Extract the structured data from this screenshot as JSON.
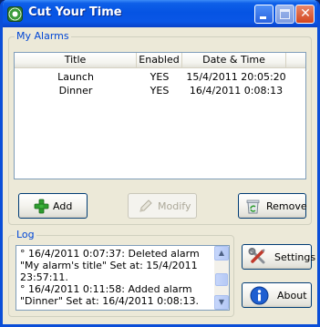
{
  "window": {
    "title": "Cut Your Time",
    "min_glyph": "",
    "max_glyph": "",
    "close_glyph": "✕"
  },
  "alarms": {
    "group_label": "My Alarms",
    "columns": [
      "Title",
      "Enabled",
      "Date & Time"
    ],
    "rows": [
      {
        "title": "Launch",
        "enabled": "YES",
        "datetime": "15/4/2011 20:05:20"
      },
      {
        "title": "Dinner",
        "enabled": "YES",
        "datetime": "16/4/2011 0:08:13"
      }
    ]
  },
  "buttons": {
    "add": "Add",
    "modify": "Modify",
    "remove": "Remove",
    "settings": "Settings",
    "about": "About"
  },
  "log": {
    "group_label": "Log",
    "text": "° 16/4/2011 0:07:37: Deleted alarm \"My alarm's title\" Set at: 15/4/2011 23:57:11.\n° 16/4/2011 0:11:58: Added alarm \"Dinner\" Set at: 16/4/2011 0:08:13."
  },
  "icons": {
    "app": "alarm-clock-icon",
    "add": "plus-icon",
    "modify": "pencil-icon",
    "remove": "recycle-bin-icon",
    "settings": "tools-icon",
    "about": "info-icon"
  },
  "colors": {
    "titlebar": "#0554e3",
    "group_label": "#0046d5",
    "window_bg": "#ece9d8"
  }
}
